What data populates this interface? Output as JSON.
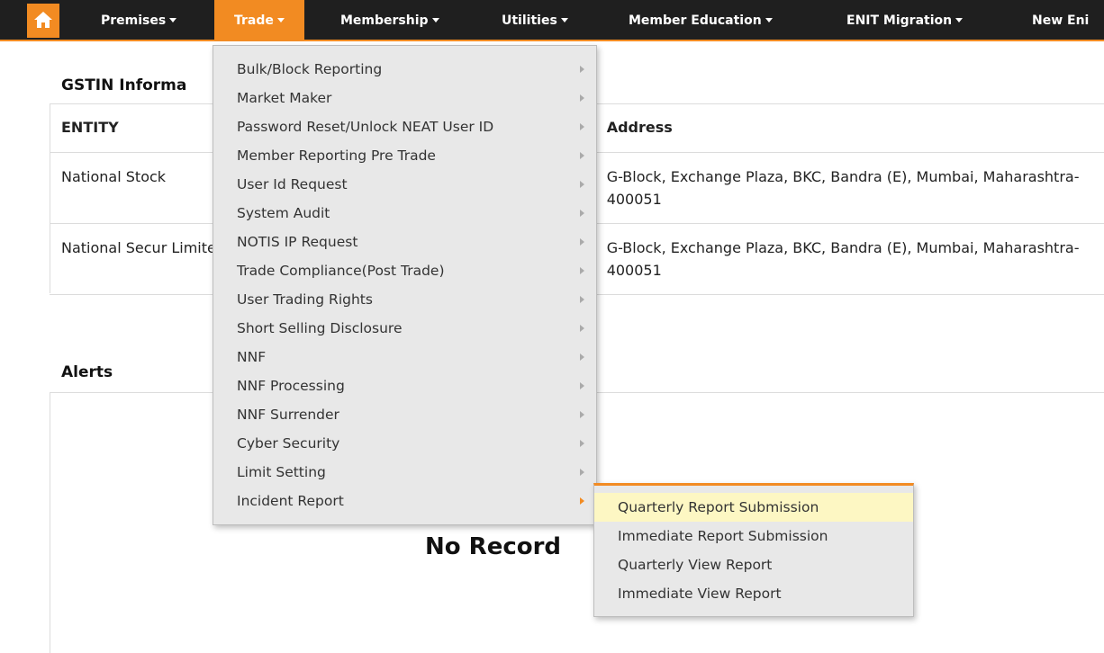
{
  "nav": {
    "items": [
      {
        "label": "Premises"
      },
      {
        "label": "Trade"
      },
      {
        "label": "Membership"
      },
      {
        "label": "Utilities"
      },
      {
        "label": "Member Education"
      },
      {
        "label": "ENIT Migration"
      },
      {
        "label": "New Eni"
      }
    ],
    "active": "Trade",
    "accent_color": "#f28b22",
    "bar_color": "#1f1f1f"
  },
  "gstin": {
    "title": "GSTIN Informa",
    "headers": [
      "ENTITY",
      "Address"
    ],
    "rows": [
      {
        "entity": "National Stock",
        "address": "G-Block, Exchange Plaza, BKC, Bandra (E), Mumbai, Maharashtra-400051"
      },
      {
        "entity": "National Secur Limited",
        "address": "G-Block, Exchange Plaza, BKC, Bandra (E), Mumbai, Maharashtra-400051"
      }
    ]
  },
  "alerts": {
    "title": "Alerts",
    "empty_message": "No Record"
  },
  "trade_menu": {
    "items": [
      {
        "label": "Bulk/Block Reporting"
      },
      {
        "label": "Market Maker"
      },
      {
        "label": "Password Reset/Unlock NEAT User ID"
      },
      {
        "label": "Member Reporting Pre Trade"
      },
      {
        "label": "User Id Request"
      },
      {
        "label": "System Audit"
      },
      {
        "label": "NOTIS IP Request"
      },
      {
        "label": "Trade Compliance(Post Trade)"
      },
      {
        "label": "User Trading Rights"
      },
      {
        "label": "Short Selling Disclosure"
      },
      {
        "label": "NNF"
      },
      {
        "label": "NNF Processing"
      },
      {
        "label": "NNF Surrender"
      },
      {
        "label": "Cyber Security"
      },
      {
        "label": "Limit Setting"
      },
      {
        "label": "Incident Report"
      }
    ],
    "open_item": "Incident Report"
  },
  "incident_submenu": {
    "items": [
      {
        "label": "Quarterly Report Submission"
      },
      {
        "label": "Immediate Report Submission"
      },
      {
        "label": "Quarterly View Report"
      },
      {
        "label": "Immediate View Report"
      }
    ],
    "hovered_item": "Quarterly Report Submission",
    "hover_color": "#fdf7c3"
  }
}
